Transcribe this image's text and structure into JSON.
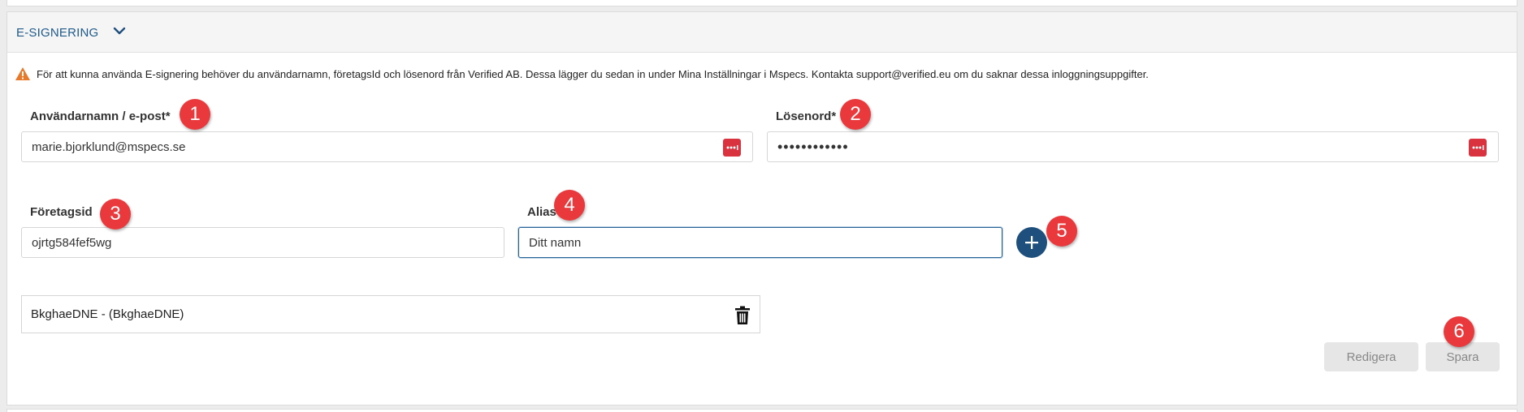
{
  "section": {
    "title": "E-SIGNERING",
    "chevron_icon": "chevron-down-icon"
  },
  "notice": {
    "icon": "warning-icon",
    "text": "För att kunna använda E-signering behöver du användarnamn, företagsId och lösenord från Verified AB. Dessa lägger du sedan in under Mina Inställningar i Mspecs. Kontakta support@verified.eu om du saknar dessa inloggningsuppgifter."
  },
  "fields": {
    "username": {
      "label": "Användarnamn / e-post*",
      "value": "marie.bjorklund@mspecs.se"
    },
    "password": {
      "label": "Lösenord*",
      "value": "••••••••••••"
    },
    "company_id": {
      "label": "Företagsid",
      "value": "ojrtg584fef5wg"
    },
    "alias": {
      "label": "Alias",
      "value": "Ditt namn"
    }
  },
  "list": {
    "items": [
      {
        "label": "BkghaeDNE - (BkghaeDNE)"
      }
    ]
  },
  "buttons": {
    "edit": "Redigera",
    "save": "Spara"
  },
  "badges": [
    "1",
    "2",
    "3",
    "4",
    "5",
    "6"
  ],
  "colors": {
    "accent": "#1f4f7d",
    "title": "#1f5a8a",
    "badge": "#e9393c",
    "password_manager": "#d9333f",
    "warning": "#e8792b"
  }
}
